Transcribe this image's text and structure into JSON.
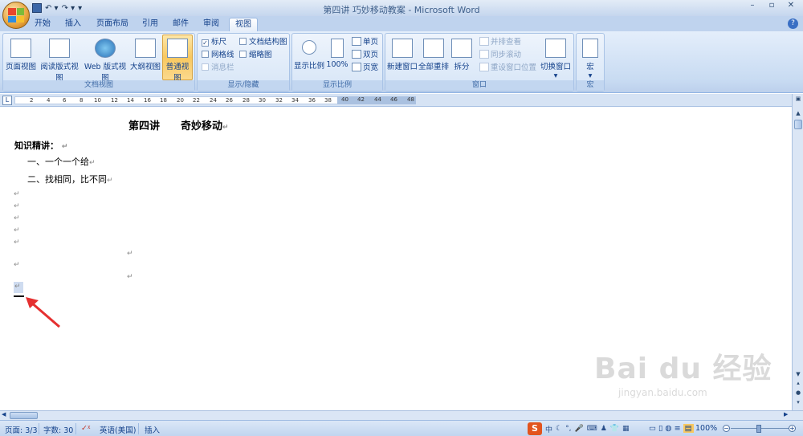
{
  "window": {
    "title": "第四讲 巧妙移动教案 - Microsoft Word",
    "controls": {
      "minimize": "–",
      "restore": "▫",
      "close": "✕"
    }
  },
  "tabs": [
    "开始",
    "插入",
    "页面布局",
    "引用",
    "邮件",
    "审阅",
    "视图"
  ],
  "active_tab": "视图",
  "ribbon": {
    "doc_views": {
      "label": "文档视图",
      "buttons": [
        "页面视图",
        "阅读版式视图",
        "Web 版式视图",
        "大纲视图",
        "普通视图"
      ],
      "selected": "普通视图"
    },
    "show_hide": {
      "label": "显示/隐藏",
      "items": [
        {
          "text": "标尺",
          "checked": true,
          "disabled": false
        },
        {
          "text": "网格线",
          "checked": false,
          "disabled": false
        },
        {
          "text": "消息栏",
          "checked": false,
          "disabled": true
        },
        {
          "text": "文档结构图",
          "checked": false,
          "disabled": false
        },
        {
          "text": "缩略图",
          "checked": false,
          "disabled": false
        }
      ]
    },
    "zoom": {
      "label": "显示比例",
      "big": [
        "显示比例",
        "100%"
      ],
      "small": [
        "单页",
        "双页",
        "页宽"
      ]
    },
    "window": {
      "label": "窗口",
      "big": [
        "新建窗口",
        "全部重排",
        "拆分"
      ],
      "small": [
        "并排查看",
        "同步滚动",
        "重设窗口位置"
      ],
      "switch": "切换窗口"
    },
    "macro": {
      "label": "宏",
      "button": "宏"
    }
  },
  "ruler": {
    "numbers": [
      "2",
      "4",
      "6",
      "8",
      "10",
      "12",
      "14",
      "16",
      "18",
      "20",
      "22",
      "24",
      "26",
      "28",
      "30",
      "32",
      "34",
      "36",
      "38"
    ],
    "grey_numbers": [
      "40",
      "42",
      "44",
      "46",
      "48"
    ]
  },
  "document": {
    "title": "第四讲　　奇妙移动",
    "heading": "知识精讲：",
    "items": [
      "一、一个一个给",
      "二、找相同，比不同"
    ],
    "para_mark": "↵"
  },
  "statusbar": {
    "page": "页面: 3/3",
    "words": "字数: 30",
    "language": "英语(美国)",
    "mode": "插入",
    "ime_logo": "S",
    "ime_mode": "中",
    "zoom": "100%"
  },
  "watermark": {
    "brand": "Bai du 经验",
    "url": "jingyan.baidu.com"
  },
  "colors": {
    "accent": "#15428b",
    "selected_button": "#f8c860",
    "annotation_arrow": "#e53030"
  }
}
